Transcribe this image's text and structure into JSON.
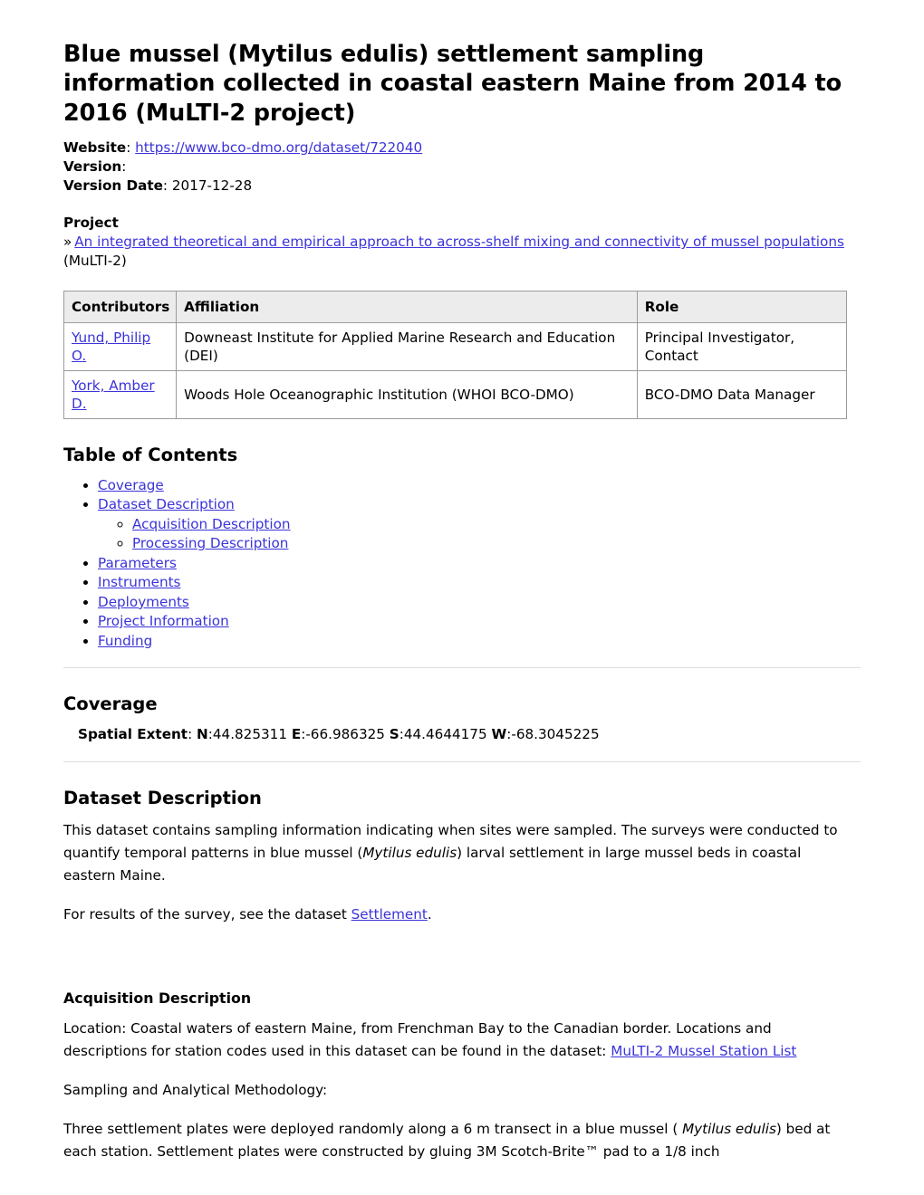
{
  "document": {
    "title": "Blue mussel (Mytilus edulis) settlement sampling information collected in coastal eastern Maine from 2014 to 2016 (MuLTI-2 project)",
    "website_label": "Website",
    "website_url_text": "https://www.bco-dmo.org/dataset/722040",
    "version_label": "Version",
    "version_value": "",
    "version_date_label": "Version Date",
    "version_date_value": "2017-12-28"
  },
  "project": {
    "heading": "Project",
    "marker": "»",
    "link_text": "An integrated theoretical and empirical approach to across-shelf mixing and connectivity of mussel populations",
    "suffix": " (MuLTI-2)"
  },
  "contributors_table": {
    "headers": [
      "Contributors",
      "Affiliation",
      "Role"
    ],
    "rows": [
      {
        "name": "Yund, Philip O.",
        "affiliation": "Downeast Institute for Applied Marine Research and Education (DEI)",
        "role": "Principal Investigator, Contact"
      },
      {
        "name": "York, Amber D.",
        "affiliation": "Woods Hole Oceanographic Institution (WHOI BCO-DMO)",
        "role": "BCO-DMO Data Manager"
      }
    ]
  },
  "toc": {
    "heading": "Table of Contents",
    "items": [
      {
        "label": "Coverage",
        "children": []
      },
      {
        "label": "Dataset Description",
        "children": [
          {
            "label": "Acquisition Description"
          },
          {
            "label": "Processing Description"
          }
        ]
      },
      {
        "label": "Parameters",
        "children": []
      },
      {
        "label": "Instruments",
        "children": []
      },
      {
        "label": "Deployments",
        "children": []
      },
      {
        "label": "Project Information",
        "children": []
      },
      {
        "label": "Funding",
        "children": []
      }
    ]
  },
  "coverage": {
    "heading": "Coverage",
    "spatial_extent_label": "Spatial Extent",
    "n_label": "N",
    "n_value": ":44.825311",
    "e_label": "E",
    "e_value": ":-66.986325",
    "s_label": "S",
    "s_value": ":44.4644175",
    "w_label": "W",
    "w_value": ":-68.3045225"
  },
  "dataset_description": {
    "heading": "Dataset Description",
    "paragraph1_a": "This dataset contains sampling information indicating when sites were sampled. The surveys were conducted to quantify temporal patterns in blue mussel (",
    "paragraph1_italic": "Mytilus edulis",
    "paragraph1_b": ") larval settlement in large mussel beds in coastal eastern Maine.",
    "paragraph2_a": "For results of the survey, see the dataset ",
    "paragraph2_link": "Settlement",
    "paragraph2_b": "."
  },
  "acquisition_description": {
    "heading": "Acquisition Description",
    "location_text": "Location: Coastal waters of eastern Maine, from Frenchman Bay to the Canadian border. Locations and descriptions for station codes used in this dataset can be found in the dataset: ",
    "location_link": "MuLTI-2 Mussel Station List",
    "methodology_heading": "Sampling and Analytical Methodology:",
    "methodology_a": "Three settlement plates were deployed randomly along a 6 m transect in a blue mussel ( ",
    "methodology_italic": "Mytilus edulis",
    "methodology_b": ") bed at each station. Settlement plates were constructed by gluing 3M Scotch-Brite™ pad to a 1/8 inch"
  },
  "colors": {
    "link": "#3b33d9",
    "table_border": "#9b9b9b",
    "table_header_bg": "#ececec",
    "rule": "#dddddd",
    "text": "#000000"
  }
}
